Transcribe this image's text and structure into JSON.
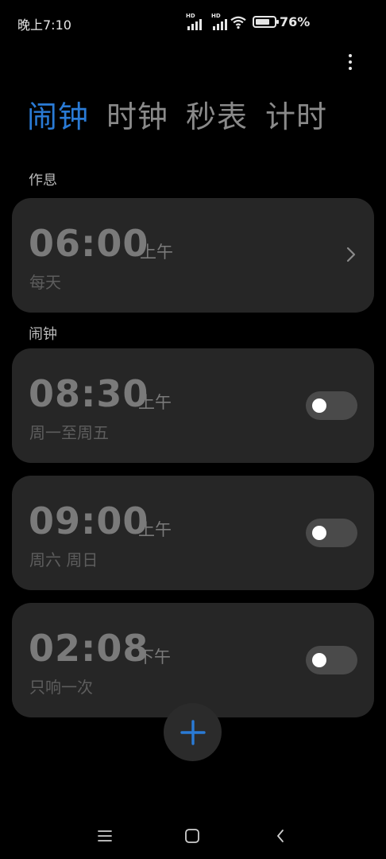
{
  "status_bar": {
    "time": "晚上7:10",
    "battery_percent": "76%",
    "battery_level": 0.76,
    "signal_labels": [
      "HD",
      "HD"
    ]
  },
  "tabs": [
    {
      "label": "闹钟",
      "active": true
    },
    {
      "label": "时钟",
      "active": false
    },
    {
      "label": "秒表",
      "active": false
    },
    {
      "label": "计时",
      "active": false
    }
  ],
  "sections": {
    "work_label": "作息",
    "alarm_label": "闹钟"
  },
  "work_alarm": {
    "time": "06:00",
    "ampm": "上午",
    "repeat": "每天"
  },
  "alarms": [
    {
      "time": "08:30",
      "ampm": "上午",
      "repeat": "周一至周五",
      "enabled": false
    },
    {
      "time": "09:00",
      "ampm": "上午",
      "repeat": "周六 周日",
      "enabled": false
    },
    {
      "time": "02:08",
      "ampm": "下午",
      "repeat": "只响一次",
      "enabled": false
    }
  ],
  "colors": {
    "accent": "#2a7bd6",
    "background": "#000000",
    "card": "#262626",
    "toggle_off": "#4a4a4a"
  },
  "icons": {
    "more": "more-vertical-icon",
    "chevron": "chevron-right-icon",
    "add": "plus-icon",
    "nav_menu": "menu-icon",
    "nav_home": "square-home-icon",
    "nav_back": "back-chevron-icon"
  }
}
